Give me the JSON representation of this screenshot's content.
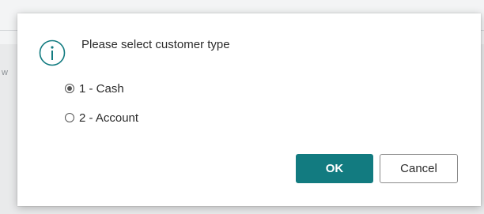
{
  "dialog": {
    "message": "Please select customer type",
    "options": [
      {
        "label": "1 - Cash",
        "selected": true
      },
      {
        "label": "2 - Account",
        "selected": false
      }
    ],
    "buttons": {
      "ok_label": "OK",
      "cancel_label": "Cancel"
    },
    "icon": "info-icon"
  },
  "background": {
    "left_fragment": "w",
    "right_fragment": "e"
  },
  "colors": {
    "accent": "#127b80",
    "icon": "#127b80"
  }
}
